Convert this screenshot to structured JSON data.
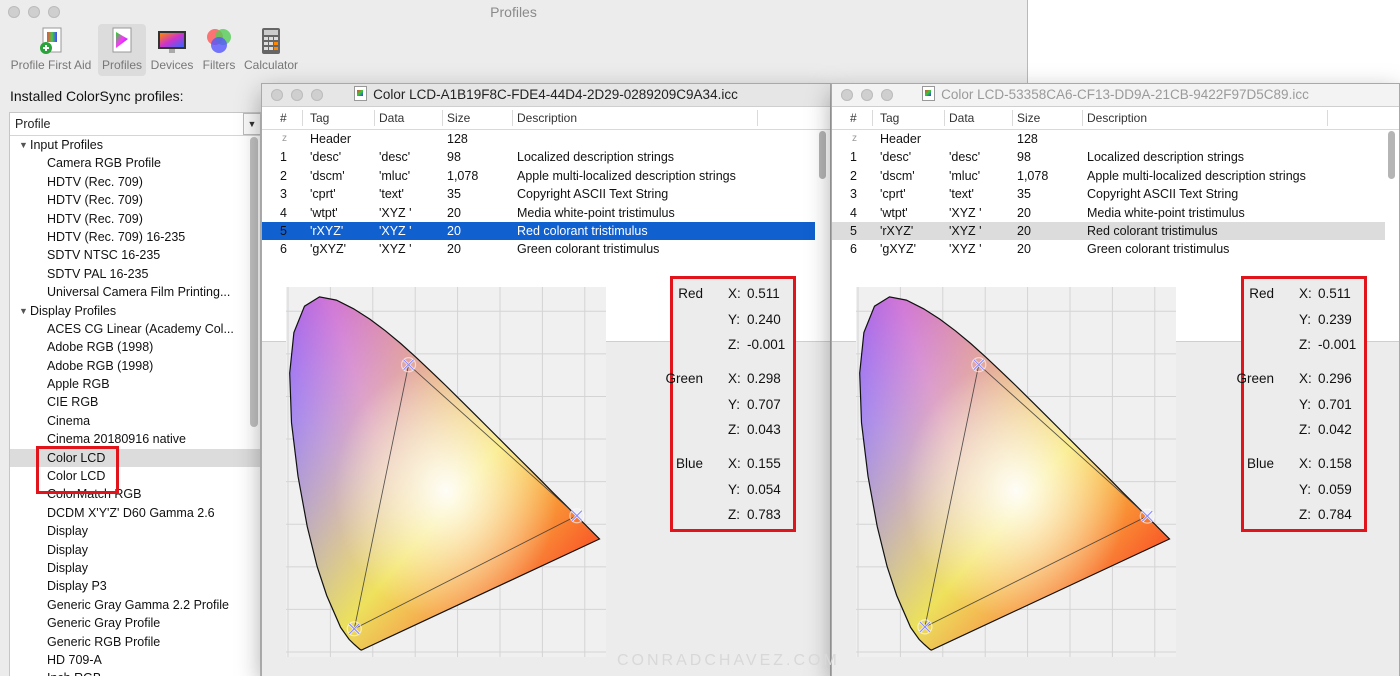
{
  "app": {
    "title": "Profiles",
    "toolbar": [
      {
        "label": "Profile First Aid",
        "icon": "first-aid-icon"
      },
      {
        "label": "Profiles",
        "icon": "profiles-icon"
      },
      {
        "label": "Devices",
        "icon": "devices-icon"
      },
      {
        "label": "Filters",
        "icon": "filters-icon"
      },
      {
        "label": "Calculator",
        "icon": "calculator-icon"
      }
    ],
    "installed_label": "Installed ColorSync profiles:",
    "sidebar_header": "Profile",
    "groups": [
      {
        "label": "Input Profiles",
        "items": [
          "Camera RGB Profile",
          "HDTV (Rec. 709)",
          "HDTV (Rec. 709)",
          "HDTV (Rec. 709)",
          "HDTV (Rec. 709) 16-235",
          "SDTV NTSC 16-235",
          "SDTV PAL 16-235",
          "Universal Camera Film Printing..."
        ]
      },
      {
        "label": "Display Profiles",
        "items": [
          "ACES CG Linear (Academy Col...",
          "Adobe RGB (1998)",
          "Adobe RGB (1998)",
          "Apple RGB",
          "CIE RGB",
          "Cinema",
          "Cinema 20180916 native",
          "Color LCD",
          "Color LCD",
          "ColorMatch RGB",
          "DCDM X'Y'Z' D60 Gamma 2.6",
          "Display",
          "Display",
          "Display",
          "Display P3",
          "Generic Gray Gamma 2.2 Profile",
          "Generic Gray Profile",
          "Generic RGB Profile",
          "HD 709-A",
          "Inch RGB"
        ]
      }
    ]
  },
  "table_headers": {
    "num": "#",
    "tag": "Tag",
    "data": "Data",
    "size": "Size",
    "desc": "Description"
  },
  "windows": [
    {
      "title": "Color LCD-A1B19F8C-FDE4-44D4-2D29-0289209C9A34.icc",
      "rows": [
        {
          "num": "z",
          "tag": "Header",
          "data": "",
          "size": "128",
          "desc": ""
        },
        {
          "num": "1",
          "tag": "'desc'",
          "data": "'desc'",
          "size": "98",
          "desc": "Localized description strings"
        },
        {
          "num": "2",
          "tag": "'dscm'",
          "data": "'mluc'",
          "size": "1,078",
          "desc": "Apple multi-localized description strings"
        },
        {
          "num": "3",
          "tag": "'cprt'",
          "data": "'text'",
          "size": "35",
          "desc": "Copyright ASCII Text String"
        },
        {
          "num": "4",
          "tag": "'wtpt'",
          "data": "'XYZ '",
          "size": "20",
          "desc": "Media white-point tristimulus"
        },
        {
          "num": "5",
          "tag": "'rXYZ'",
          "data": "'XYZ '",
          "size": "20",
          "desc": "Red colorant tristimulus"
        },
        {
          "num": "6",
          "tag": "'gXYZ'",
          "data": "'XYZ '",
          "size": "20",
          "desc": "Green colorant tristimulus"
        }
      ],
      "values": [
        {
          "color": "Red",
          "x": "0.511",
          "y": "0.240",
          "z": "-0.001"
        },
        {
          "color": "Green",
          "x": "0.298",
          "y": "0.707",
          "z": "0.043"
        },
        {
          "color": "Blue",
          "x": "0.155",
          "y": "0.054",
          "z": "0.783"
        }
      ]
    },
    {
      "title": "Color LCD-53358CA6-CF13-DD9A-21CB-9422F97D5C89.icc",
      "rows": [
        {
          "num": "z",
          "tag": "Header",
          "data": "",
          "size": "128",
          "desc": ""
        },
        {
          "num": "1",
          "tag": "'desc'",
          "data": "'desc'",
          "size": "98",
          "desc": "Localized description strings"
        },
        {
          "num": "2",
          "tag": "'dscm'",
          "data": "'mluc'",
          "size": "1,078",
          "desc": "Apple multi-localized description strings"
        },
        {
          "num": "3",
          "tag": "'cprt'",
          "data": "'text'",
          "size": "35",
          "desc": "Copyright ASCII Text String"
        },
        {
          "num": "4",
          "tag": "'wtpt'",
          "data": "'XYZ '",
          "size": "20",
          "desc": "Media white-point tristimulus"
        },
        {
          "num": "5",
          "tag": "'rXYZ'",
          "data": "'XYZ '",
          "size": "20",
          "desc": "Red colorant tristimulus"
        },
        {
          "num": "6",
          "tag": "'gXYZ'",
          "data": "'XYZ '",
          "size": "20",
          "desc": "Green colorant tristimulus"
        }
      ],
      "values": [
        {
          "color": "Red",
          "x": "0.511",
          "y": "0.239",
          "z": "-0.001"
        },
        {
          "color": "Green",
          "x": "0.296",
          "y": "0.701",
          "z": "0.042"
        },
        {
          "color": "Blue",
          "x": "0.158",
          "y": "0.059",
          "z": "0.784"
        }
      ]
    }
  ],
  "value_axes": [
    "X:",
    "Y:",
    "Z:"
  ],
  "watermark": "CONRADCHAVEZ.COM",
  "colors": {
    "highlight_box": "#e0141a",
    "selection": "#1160d0"
  }
}
